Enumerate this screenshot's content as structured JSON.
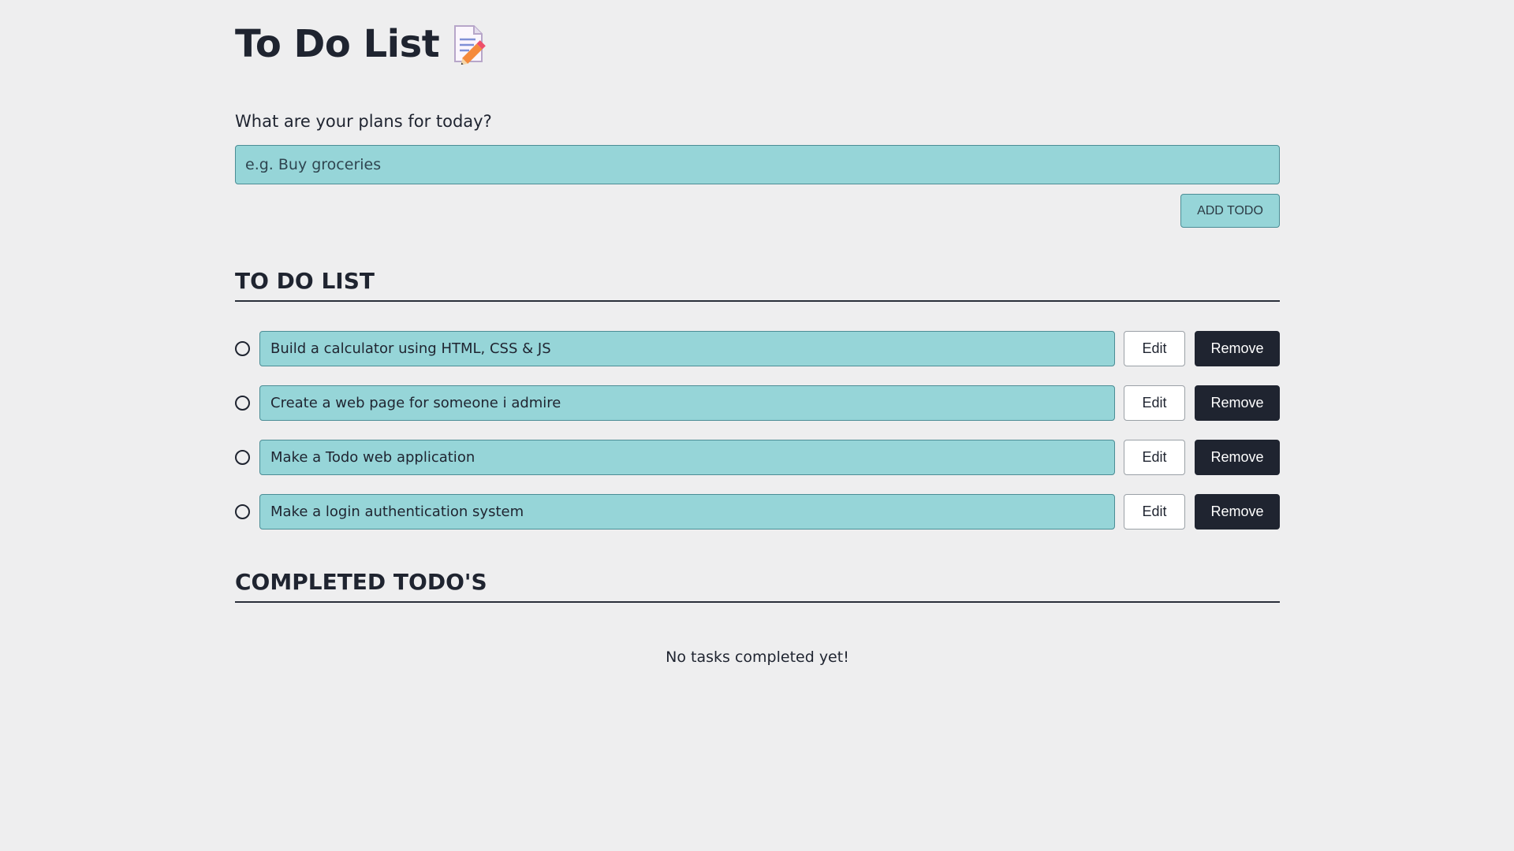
{
  "header": {
    "title": "To Do List",
    "icon": "memo-pencil-icon"
  },
  "new_todo": {
    "label": "What are your plans for today?",
    "placeholder": "e.g. Buy groceries",
    "value": "",
    "add_button_label": "ADD TODO"
  },
  "todo_section": {
    "heading": "TO DO LIST",
    "items": [
      {
        "text": "Build a calculator using HTML, CSS & JS",
        "completed": false,
        "edit_label": "Edit",
        "remove_label": "Remove"
      },
      {
        "text": "Create a web page for someone i admire",
        "completed": false,
        "edit_label": "Edit",
        "remove_label": "Remove"
      },
      {
        "text": "Make a Todo web application",
        "completed": false,
        "edit_label": "Edit",
        "remove_label": "Remove"
      },
      {
        "text": "Make a login authentication system",
        "completed": false,
        "edit_label": "Edit",
        "remove_label": "Remove"
      }
    ]
  },
  "completed_section": {
    "heading": "COMPLETED TODO'S",
    "empty_message": "No tasks completed yet!"
  },
  "colors": {
    "background": "#eeeeef",
    "accent": "#96d5d8",
    "accent_border": "#4b8d95",
    "dark": "#1f2430"
  }
}
